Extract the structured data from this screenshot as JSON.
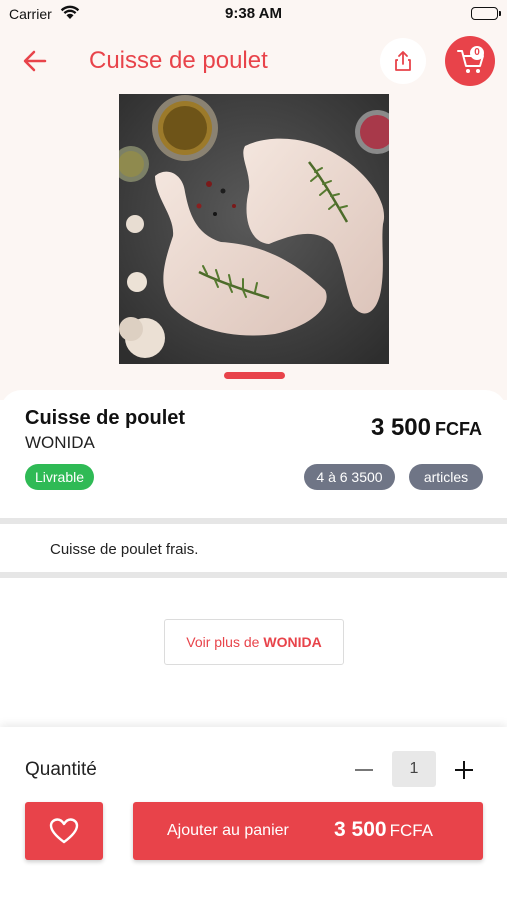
{
  "status_bar": {
    "carrier": "Carrier",
    "time": "9:38 AM"
  },
  "nav": {
    "title": "Cuisse de poulet",
    "cart_count": "0"
  },
  "product": {
    "name": "Cuisse de poulet",
    "vendor": "WONIDA",
    "price": "3 500",
    "currency": "FCFA",
    "badges": {
      "delivery": "Livrable",
      "range": "4 à 6 3500",
      "unit": "articles"
    },
    "description": "Cuisse de poulet frais."
  },
  "more": {
    "prefix": "Voir plus de",
    "vendor": "WONIDA"
  },
  "bottom_bar": {
    "quantity_label": "Quantité",
    "quantity": "1",
    "add_to_cart": "Ajouter au panier",
    "price": "3 500",
    "currency": "FCFA"
  },
  "icons": [
    "wifi-icon",
    "battery-icon",
    "back-arrow-icon",
    "share-icon",
    "cart-icon",
    "minus-icon",
    "plus-icon",
    "heart-icon"
  ],
  "colors": {
    "accent": "#e8434a",
    "green_badge": "#2fba55",
    "gray_badge": "#6f7586",
    "header_bg": "#fcf6f3"
  }
}
